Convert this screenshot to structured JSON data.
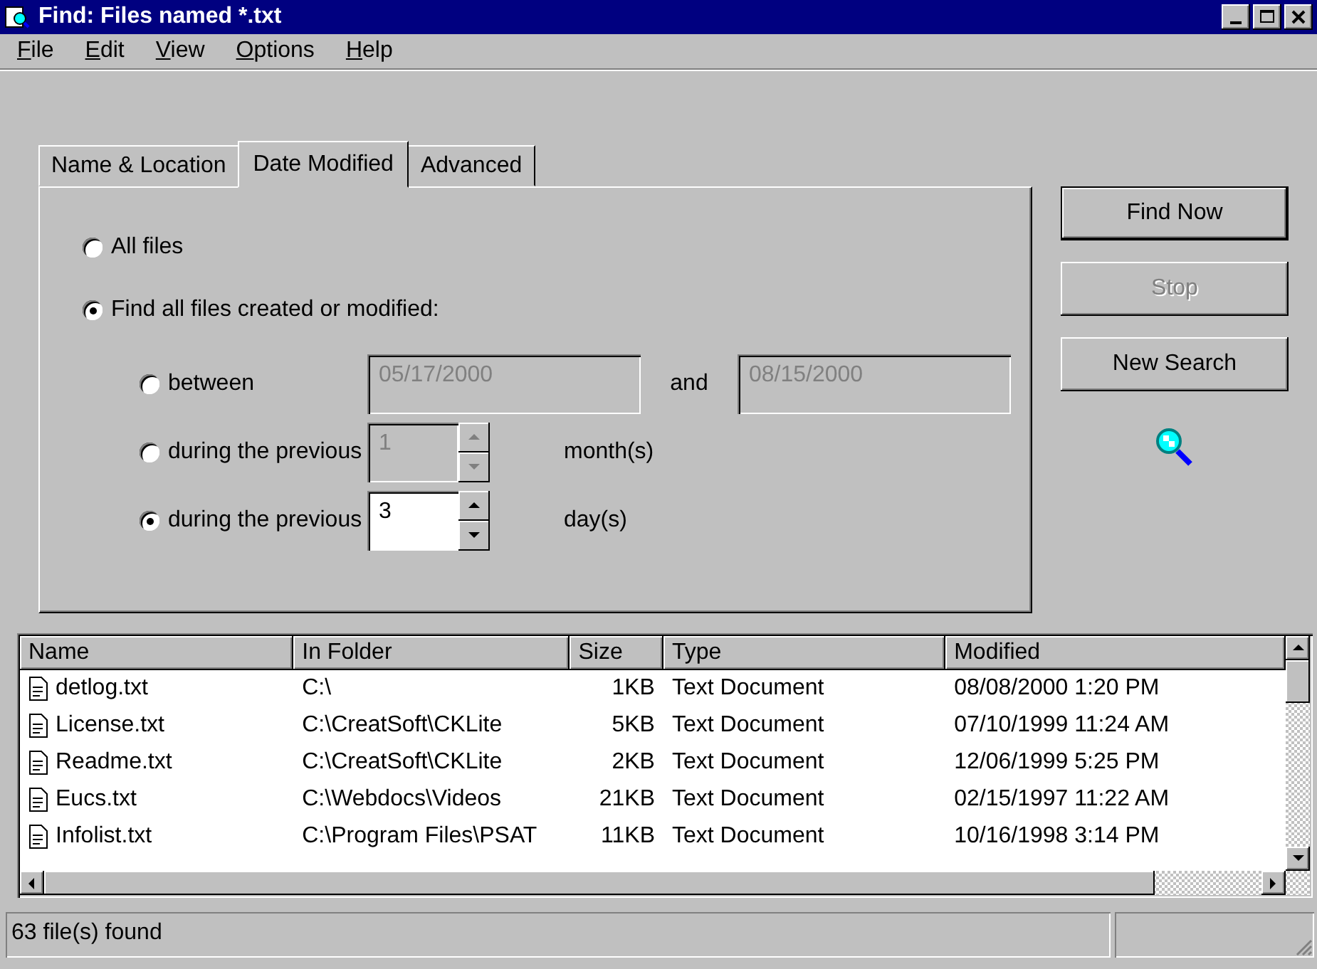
{
  "window": {
    "title": "Find: Files named *.txt"
  },
  "menu": [
    {
      "label": "File"
    },
    {
      "label": "Edit"
    },
    {
      "label": "View"
    },
    {
      "label": "Options"
    },
    {
      "label": "Help"
    }
  ],
  "tabs": [
    {
      "label": "Name & Location",
      "selected": false
    },
    {
      "label": "Date Modified",
      "selected": true
    },
    {
      "label": "Advanced",
      "selected": false
    }
  ],
  "scope_options": [
    {
      "label": "All files",
      "selected": false
    },
    {
      "label": "Find all files created or modified:",
      "selected": true
    }
  ],
  "date_options": [
    {
      "kind": "range",
      "label": "between",
      "from": "05/17/2000",
      "joiner": "and",
      "to": "08/15/2000",
      "selected": false,
      "disabled": true
    },
    {
      "kind": "spin",
      "label": "during the previous",
      "value": "1",
      "unit": "month(s)",
      "selected": false,
      "disabled": true
    },
    {
      "kind": "spin",
      "label": "during the previous",
      "value": "3",
      "unit": "day(s)",
      "selected": true,
      "disabled": false
    }
  ],
  "buttons": [
    {
      "label": "Find Now",
      "disabled": false,
      "default": true
    },
    {
      "label": "Stop",
      "disabled": true,
      "default": false
    },
    {
      "label": "New Search",
      "disabled": false,
      "default": false
    }
  ],
  "table": {
    "columns": [
      "Name",
      "In Folder",
      "Size",
      "Type",
      "Modified"
    ],
    "rows": [
      [
        "detlog.txt",
        "C:\\",
        "1KB",
        "Text Document",
        "08/08/2000 1:20 PM"
      ],
      [
        "License.txt",
        "C:\\CreatSoft\\CKLite",
        "5KB",
        "Text Document",
        "07/10/1999 11:24 AM"
      ],
      [
        "Readme.txt",
        "C:\\CreatSoft\\CKLite",
        "2KB",
        "Text Document",
        "12/06/1999 5:25 PM"
      ],
      [
        "Eucs.txt",
        "C:\\Webdocs\\Videos",
        "21KB",
        "Text Document",
        "02/15/1997 11:22 AM"
      ],
      [
        "Infolist.txt",
        "C:\\Program Files\\PSAT",
        "11KB",
        "Text Document",
        "10/16/1998 3:14 PM"
      ]
    ]
  },
  "status_bar": {
    "text": "63 file(s) found"
  }
}
